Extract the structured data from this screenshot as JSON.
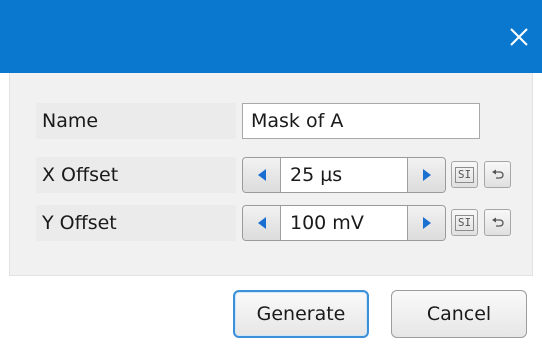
{
  "window": {
    "titlebar_color": "#0b78d0",
    "close_icon": "close-icon"
  },
  "fields": {
    "name": {
      "label": "Name",
      "value": "Mask of A"
    },
    "x_offset": {
      "label": "X Offset",
      "value": "25 µs",
      "si_label": "SI",
      "reset_icon": "undo-icon"
    },
    "y_offset": {
      "label": "Y Offset",
      "value": "100 mV",
      "si_label": "SI",
      "reset_icon": "undo-icon"
    }
  },
  "buttons": {
    "generate": "Generate",
    "cancel": "Cancel"
  },
  "colors": {
    "accent": "#0b78d0",
    "arrow": "#1a6fd1"
  }
}
